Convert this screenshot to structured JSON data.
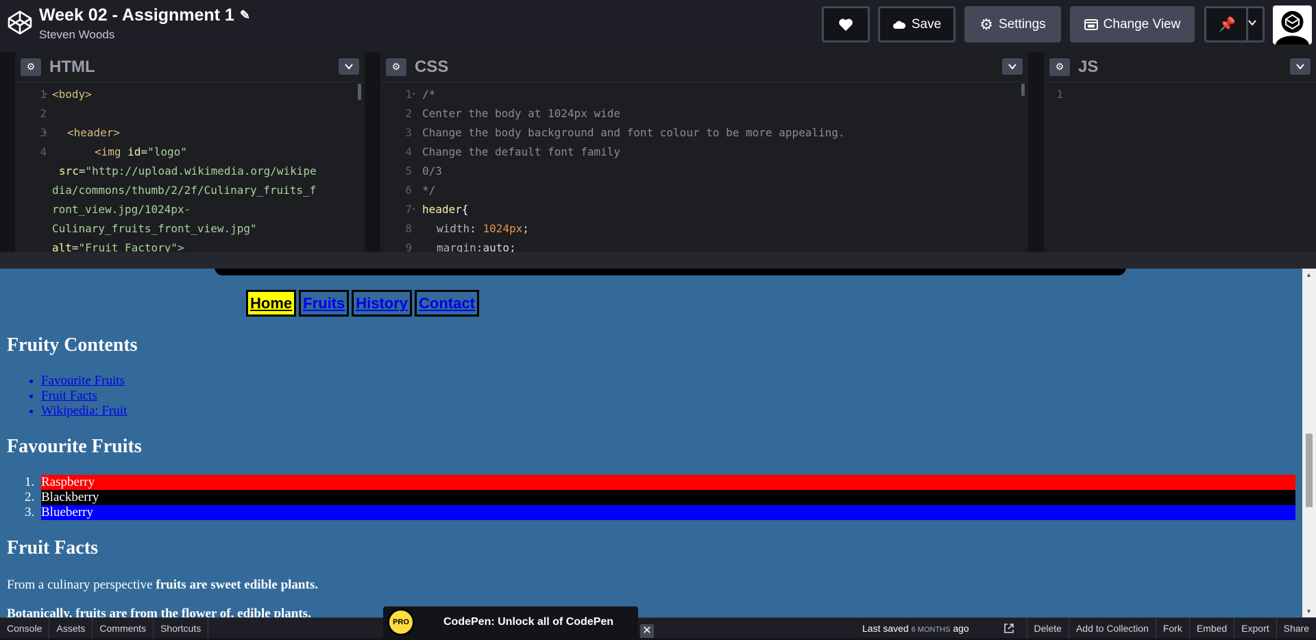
{
  "header": {
    "pen_title": "Week 02 - Assignment 1",
    "author": "Steven Woods",
    "buttons": {
      "save": "Save",
      "settings": "Settings",
      "change_view": "Change View"
    }
  },
  "editors": {
    "html": {
      "name": "HTML",
      "line_numbers": [
        "1",
        "2",
        "3",
        "4"
      ],
      "lines": {
        "l1": "<body>",
        "l3": "<header>",
        "l4_tag": "<img",
        "l4_attr": "id",
        "l4_val": "\"logo\"",
        "l5_attr": "src",
        "l5_val": "\"http://upload.wikimedia.org/wikipe",
        "l6": "dia/commons/thumb/2/2f/Culinary_fruits_f",
        "l7": "ront_view.jpg/1024px-",
        "l8": "Culinary_fruits_front_view.jpg\"",
        "l9_attr": "alt",
        "l9_val": "\"Fruit Factory\">"
      }
    },
    "css": {
      "name": "CSS",
      "line_numbers": [
        "1",
        "2",
        "3",
        "4",
        "5",
        "6",
        "7",
        "8",
        "9"
      ],
      "lines": {
        "l1": "/*",
        "l2": "Center the body at 1024px wide",
        "l3": "Change the body background and font colour to be more appealing.",
        "l4": "Change the default font family",
        "l5": "0/3",
        "l6": "*/",
        "l7_sel": "header",
        "l7_brace": "{",
        "l8_prop": "width",
        "l8_val": "1024px",
        "l9_prop": "margin",
        "l9_val": "auto"
      }
    },
    "js": {
      "name": "JS",
      "line_numbers": [
        "1"
      ]
    }
  },
  "preview": {
    "nav": [
      "Home",
      "Fruits",
      "History",
      "Contact"
    ],
    "h_contents": "Fruity Contents",
    "toc": [
      "Favourite Fruits",
      "Fruit Facts",
      "Wikipedia: Fruit"
    ],
    "h_favourites": "Favourite Fruits",
    "favourites": [
      {
        "num": "1.",
        "name": "Raspberry",
        "color": "#ff0000"
      },
      {
        "num": "2.",
        "name": "Blackberry",
        "color": "#000000"
      },
      {
        "num": "3.",
        "name": "Blueberry",
        "color": "#0000ff"
      }
    ],
    "h_facts": "Fruit Facts",
    "fact1_a": "From a culinary perspective",
    "fact1_b": "fruits are sweet edible plants.",
    "fact2": "Botanically, fruits are from the flower of, edible plants."
  },
  "bottom": {
    "left": [
      "Console",
      "Assets",
      "Comments",
      "Shortcuts"
    ],
    "saved_label": "Last saved",
    "saved_time": "6 MONTHS",
    "saved_suffix": "ago",
    "right": [
      "Delete",
      "Add to Collection",
      "Fork",
      "Embed",
      "Export",
      "Share"
    ]
  },
  "pro_banner": {
    "badge": "PRO",
    "text": "CodePen: Unlock all of CodePen"
  },
  "colors": {
    "accent_yellow": "#ffff00",
    "preview_bg": "#336a9a",
    "editor_bg": "#1d1e22"
  }
}
